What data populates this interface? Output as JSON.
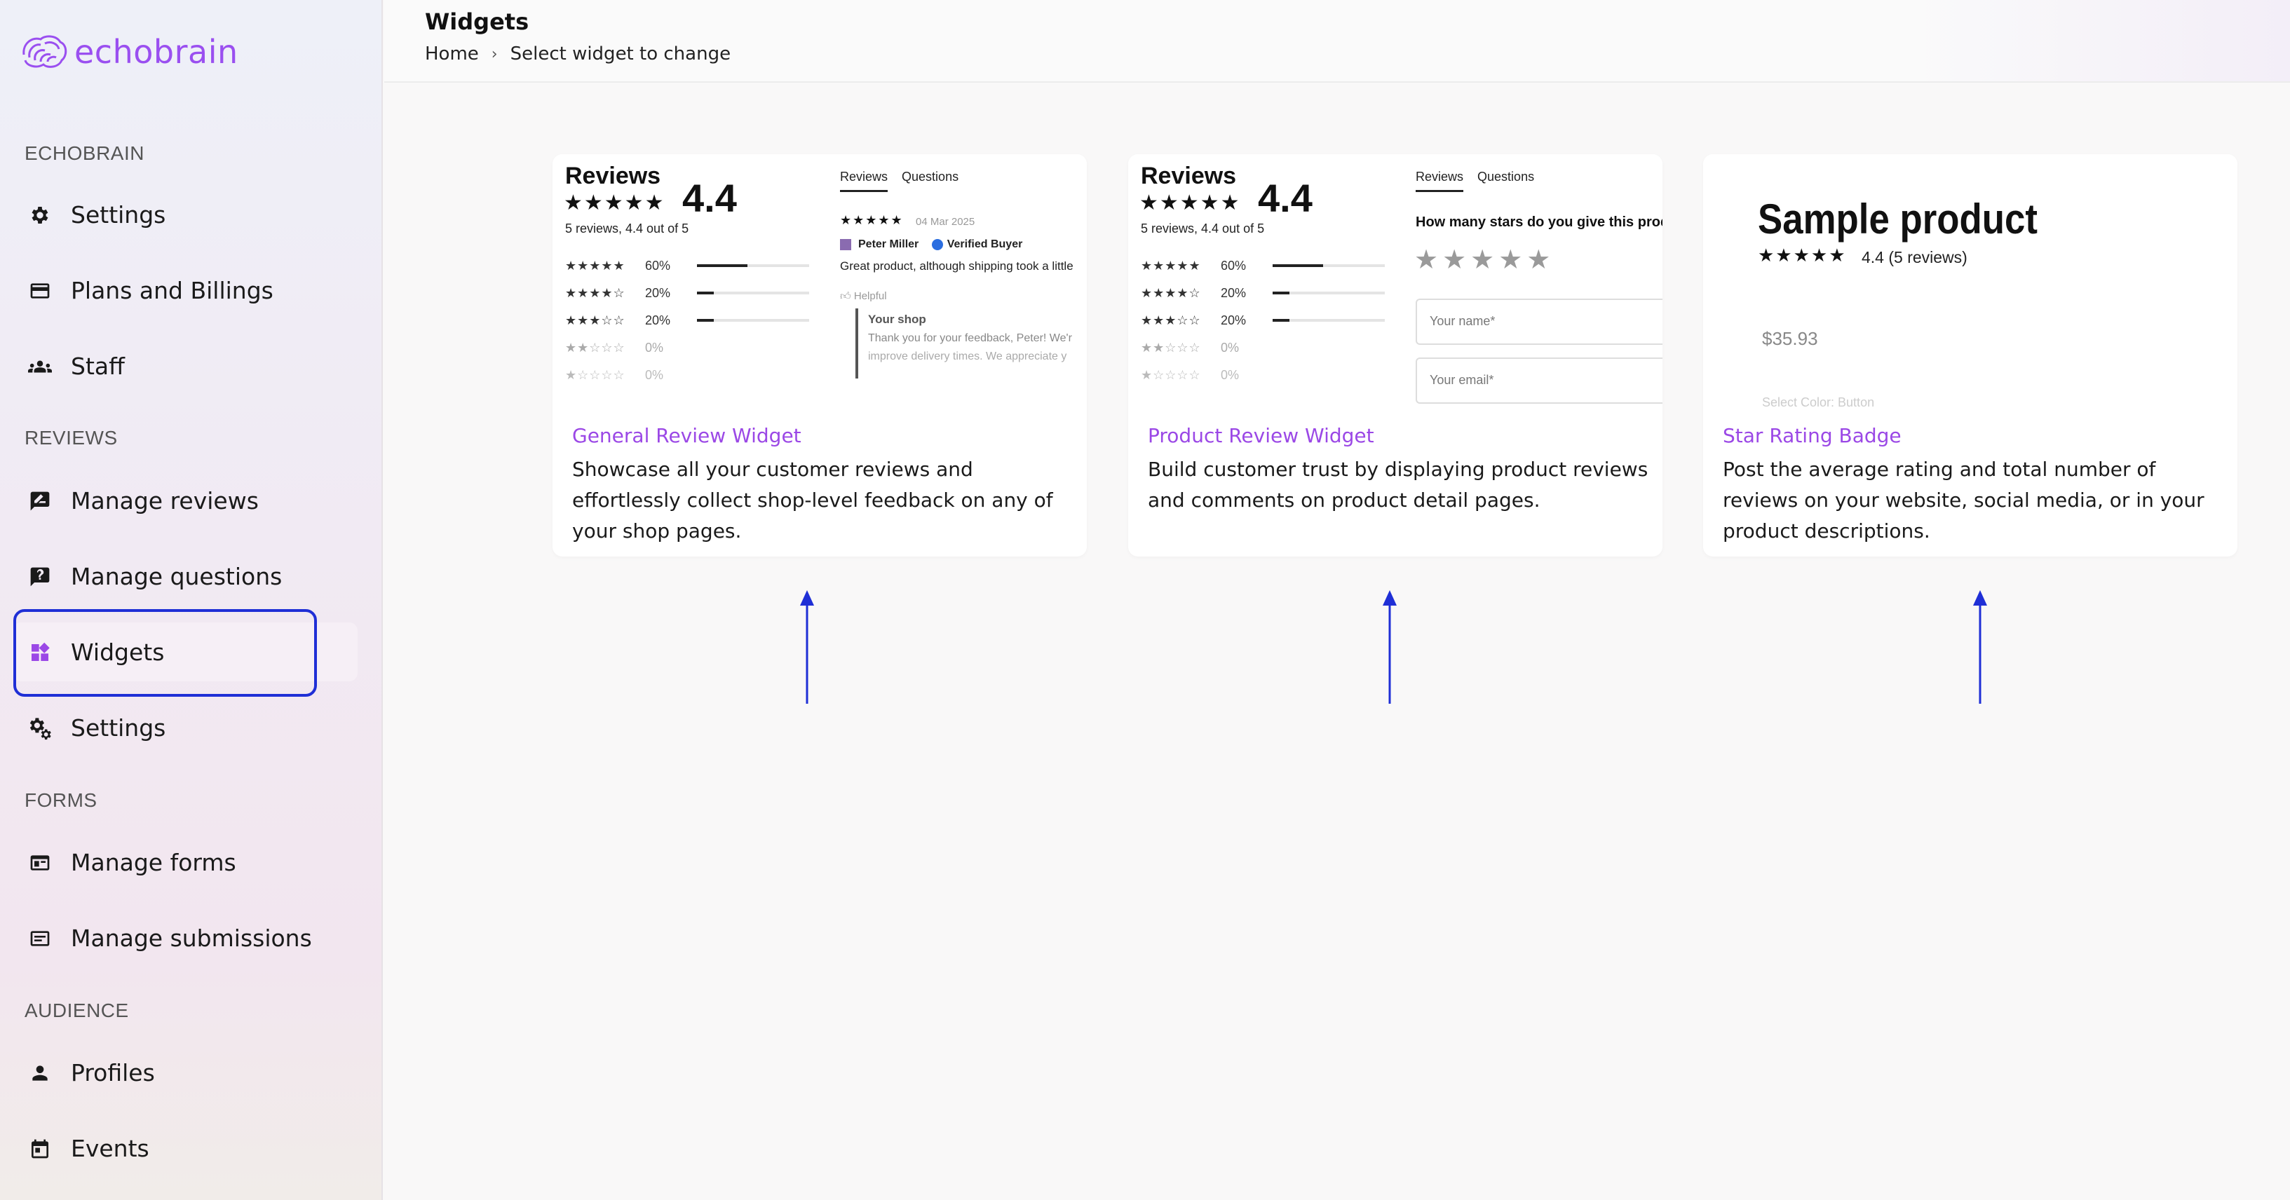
{
  "brand": {
    "name": "echobrain",
    "color": "#9a4ff0"
  },
  "sidebar": {
    "sections": [
      {
        "label": "ECHOBRAIN"
      },
      {
        "label": "REVIEWS"
      },
      {
        "label": "FORMS"
      },
      {
        "label": "AUDIENCE"
      }
    ],
    "items": [
      {
        "label": "Settings",
        "icon": "gear-icon"
      },
      {
        "label": "Plans and Billings",
        "icon": "credit-card-icon"
      },
      {
        "label": "Staff",
        "icon": "people-icon"
      },
      {
        "label": "Manage reviews",
        "icon": "rate-review-icon"
      },
      {
        "label": "Manage questions",
        "icon": "question-icon"
      },
      {
        "label": "Widgets",
        "icon": "widgets-icon",
        "active": true
      },
      {
        "label": "Settings",
        "icon": "gears-icon"
      },
      {
        "label": "Manage forms",
        "icon": "form-icon"
      },
      {
        "label": "Manage submissions",
        "icon": "submissions-icon"
      },
      {
        "label": "Profiles",
        "icon": "person-icon"
      },
      {
        "label": "Events",
        "icon": "calendar-icon"
      }
    ]
  },
  "header": {
    "title": "Widgets",
    "breadcrumb": {
      "home": "Home",
      "separator": "›",
      "current": "Select widget to change"
    }
  },
  "cards": [
    {
      "title": "General Review Widget",
      "description": "Showcase all your customer reviews and effortlessly collect shop-level feedback on any of your shop pages.",
      "preview": {
        "heading": "Reviews",
        "rating": "4.4",
        "summary": "5 reviews, 4.4 out of 5",
        "tab_reviews": "Reviews",
        "tab_questions": "Questions",
        "review_date": "04 Mar 2025",
        "reviewer": "Peter Miller",
        "verified": "Verified Buyer",
        "review_text": "Great product, although shipping took a little",
        "helpful": "Helpful",
        "reply_from": "Your shop",
        "reply_text_1": "Thank you for your feedback, Peter! We'r",
        "reply_text_2": "improve delivery times. We appreciate y"
      }
    },
    {
      "title": "Product Review Widget",
      "description": "Build customer trust by displaying product reviews and comments on product detail pages.",
      "preview": {
        "heading": "Reviews",
        "rating": "4.4",
        "summary": "5 reviews, 4.4 out of 5",
        "tab_reviews": "Reviews",
        "tab_questions": "Questions",
        "question": "How many stars do you give this product?",
        "name_placeholder": "Your name*",
        "email_placeholder": "Your email*"
      }
    },
    {
      "title": "Star Rating Badge",
      "description": "Post the average rating and total number of reviews on your website, social media, or in your product descriptions.",
      "preview": {
        "product_name": "Sample product",
        "rating_text": "4.4 (5 reviews)",
        "price": "$35.93",
        "cutoff_text": "Select Color: Button"
      }
    }
  ],
  "rating_bars": [
    {
      "stars": "★★★★★",
      "percent": "60%",
      "fraction": 0.6
    },
    {
      "stars": "★★★★☆",
      "percent": "20%",
      "fraction": 0.2
    },
    {
      "stars": "★★★☆☆",
      "percent": "20%",
      "fraction": 0.2
    },
    {
      "stars": "★★☆☆☆",
      "percent": "0%",
      "fraction": 0
    },
    {
      "stars": "★☆☆☆☆",
      "percent": "0%",
      "fraction": 0
    }
  ],
  "colors": {
    "accent": "#9b48e6",
    "highlight_box": "#1f2fd6",
    "arrow": "#1f2fd6"
  }
}
